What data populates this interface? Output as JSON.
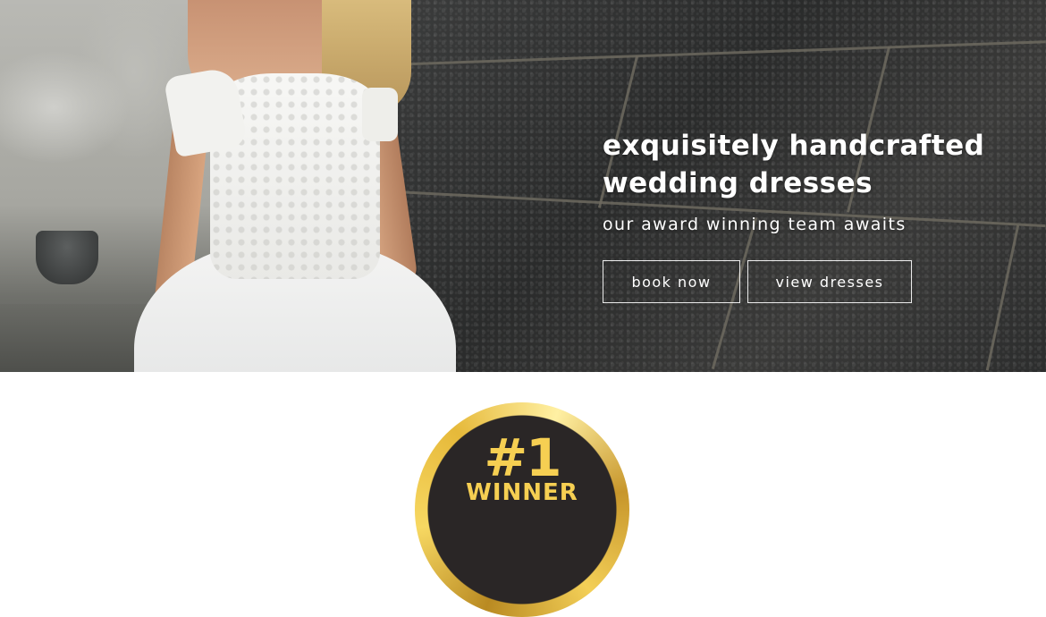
{
  "hero": {
    "headline_line1": "exquisitely handcrafted",
    "headline_line2": "wedding dresses",
    "subline": "our award winning team awaits",
    "buttons": {
      "book_label": "book now",
      "view_label": "view dresses"
    },
    "colors": {
      "text": "#ffffff",
      "button_border": "#ffffff",
      "stone_wall": "#2f3030"
    }
  },
  "badge": {
    "number": "#1",
    "word": "WINNER",
    "colors": {
      "ring": "#e8bf45",
      "disc": "#2a2626",
      "text": "#f6cf52"
    }
  }
}
